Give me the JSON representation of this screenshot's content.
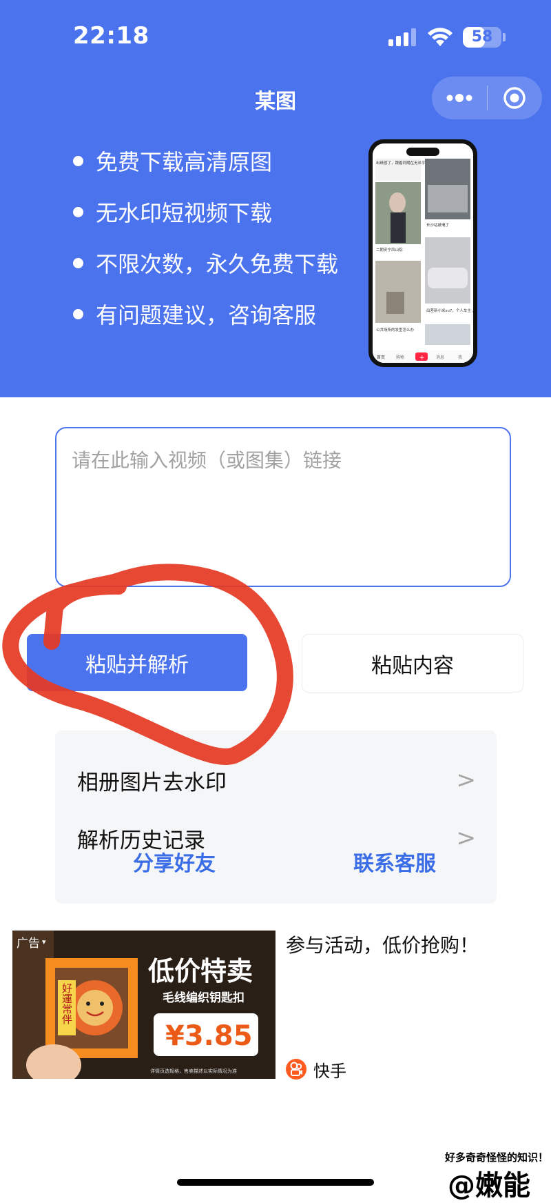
{
  "status_bar": {
    "time": "22:18",
    "battery": "58",
    "battery_level": 0.58
  },
  "header": {
    "title": "某图"
  },
  "colors": {
    "brand_blue": "#4c73ee",
    "link_blue": "#3b6ee6",
    "annotation_red": "#e53a24",
    "panel_bg": "#f5f6f8"
  },
  "features": [
    "免费下载高清原图",
    "无水印短视频下载",
    "不限次数，永久免费下载",
    "有问题建议，咨询客服"
  ],
  "link_input": {
    "placeholder": "请在此输入视频（或图集）链接",
    "value": ""
  },
  "buttons": {
    "paste_parse": "粘贴并解析",
    "paste_content": "粘贴内容"
  },
  "menu": {
    "items": [
      {
        "label": "相册图片去水印",
        "chevron": ">"
      },
      {
        "label": "解析历史记录",
        "chevron": ">"
      }
    ],
    "share": "分享好友",
    "contact": "联系客服"
  },
  "ad": {
    "badge": "广告",
    "headline": "低价特卖",
    "subhead": "毛线编织钥匙扣",
    "price": "¥3.85",
    "lucky_text": "好運常伴",
    "fine_print": "详情页选规格，售卖描述以实际情况为准",
    "caption": "参与活动，低价抢购！",
    "source": "快手"
  },
  "phone_preview": {
    "captions": [
      "出纸感了，跟着同期在无法平静",
      "长沙站被淹了",
      "二期安宁凤山院",
      "出差新小米su7，个人车主，开车跑！",
      "公共场所的发型怎么办"
    ],
    "nav": [
      "首页",
      "购物",
      "+",
      "消息",
      "我"
    ]
  },
  "watermark": {
    "line1": "好多奇奇怪怪的知识！",
    "line2": "@嫩能"
  }
}
